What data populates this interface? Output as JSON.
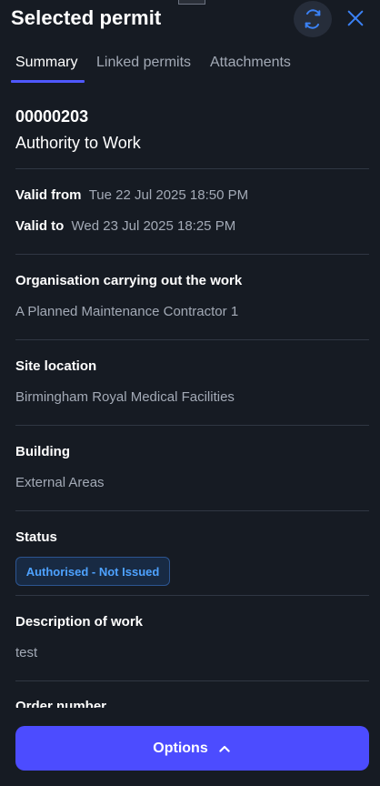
{
  "header": {
    "title": "Selected permit",
    "refresh_icon": "refresh-icon",
    "close_icon": "close-icon"
  },
  "tabs": [
    {
      "label": "Summary",
      "active": true
    },
    {
      "label": "Linked permits",
      "active": false
    },
    {
      "label": "Attachments",
      "active": false
    }
  ],
  "permit": {
    "number": "00000203",
    "type": "Authority to Work",
    "valid_from_label": "Valid from",
    "valid_from": "Tue 22 Jul 2025 18:50 PM",
    "valid_to_label": "Valid to",
    "valid_to": "Wed 23 Jul 2025 18:25 PM"
  },
  "fields": {
    "organisation_label": "Organisation carrying out the work",
    "organisation_value": "A Planned Maintenance Contractor 1",
    "site_label": "Site location",
    "site_value": "Birmingham Royal Medical Facilities",
    "building_label": "Building",
    "building_value": "External Areas",
    "status_label": "Status",
    "status_value": "Authorised - Not Issued",
    "description_label": "Description of work",
    "description_value": "test",
    "order_label": "Order number"
  },
  "footer": {
    "options_label": "Options",
    "options_icon": "chevron-up-icon"
  },
  "colors": {
    "background": "#161b23",
    "accent": "#4c4cff",
    "tab_underline": "#4f58ff",
    "status_text": "#4ea2ff",
    "icon_blue": "#3b82f6"
  }
}
